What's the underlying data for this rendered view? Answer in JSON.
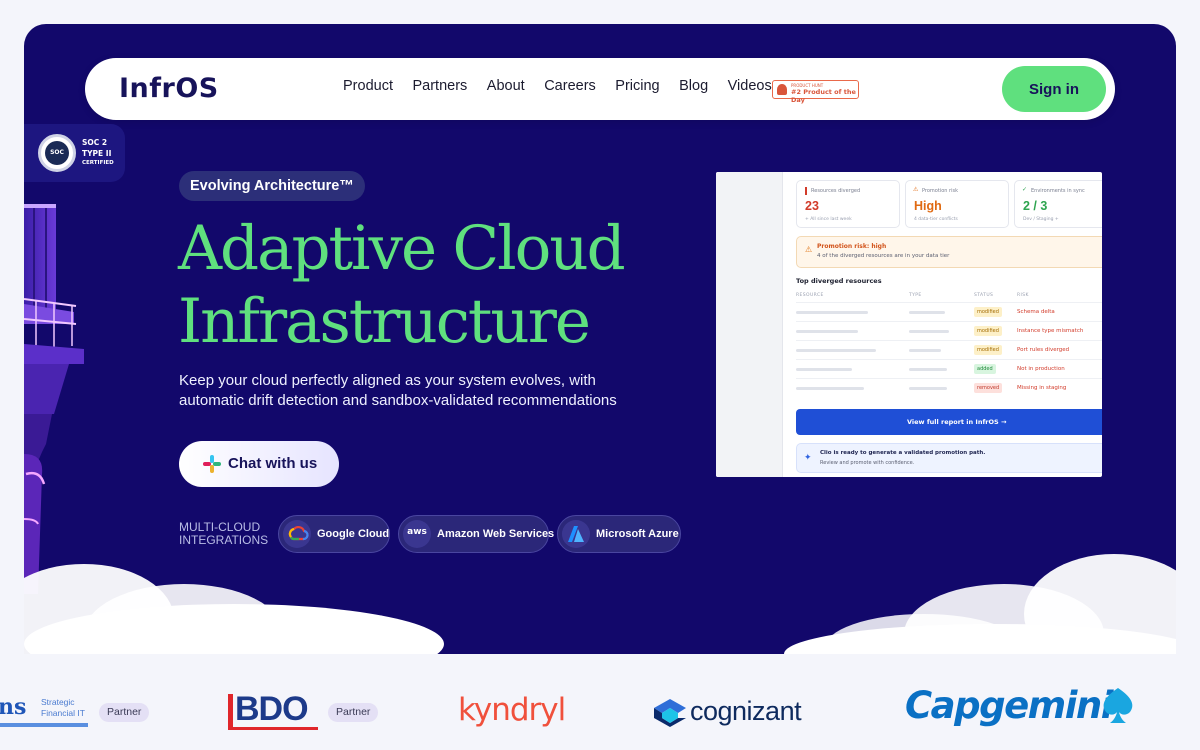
{
  "nav": {
    "logo": "InfrOS",
    "links": [
      "Product",
      "Partners",
      "About",
      "Careers",
      "Pricing",
      "Blog",
      "Videos"
    ],
    "product_hunt": {
      "small": "PRODUCT HUNT",
      "big": "#2 Product of the Day"
    },
    "signin": "Sign in"
  },
  "soc": {
    "line1": "SOC 2",
    "line2": "TYPE II",
    "line3": "CERTIFIED",
    "seal": "SOC"
  },
  "hero": {
    "pill": "Evolving Architecture™",
    "headline_line1": "Adaptive Cloud",
    "headline_line2": "Infrastructure",
    "subtext_line1": "Keep your cloud perfectly aligned as your system evolves, with",
    "subtext_line2": "automatic drift detection and sandbox-validated recommendations",
    "chat_button": "Chat with us",
    "integrations_label_line1": "MULTI-CLOUD",
    "integrations_label_line2": "INTEGRATIONS",
    "integrations": [
      {
        "name": "Google Cloud",
        "icon": "google-cloud-icon"
      },
      {
        "name": "Amazon Web Services",
        "icon": "aws-icon",
        "glyph": "aws"
      },
      {
        "name": "Microsoft Azure",
        "icon": "azure-icon"
      }
    ]
  },
  "dashboard": {
    "stats": [
      {
        "label": "Resources diverged",
        "value": "23",
        "sub": "+ All since last week",
        "color": "#d23b2a"
      },
      {
        "label": "Promotion risk",
        "value": "High",
        "sub": "4 data-tier conflicts",
        "color": "#e06a12"
      },
      {
        "label": "Environments in sync",
        "value": "2 / 3",
        "sub": "Dev / Staging +",
        "color": "#2ea44f"
      }
    ],
    "risk_title": "Promotion risk: high",
    "risk_sub": "4 of the diverged resources are in your data tier",
    "table_title": "Top diverged resources",
    "headers": [
      "RESOURCE",
      "TYPE",
      "STATUS",
      "RISK"
    ],
    "rows": [
      {
        "status": "modified",
        "risk": "Schema delta"
      },
      {
        "status": "modified",
        "risk": "Instance type mismatch"
      },
      {
        "status": "modified",
        "risk": "Port rules diverged"
      },
      {
        "status": "added",
        "risk": "Not in production"
      },
      {
        "status": "removed",
        "risk": "Missing in staging"
      }
    ],
    "view_button": "View full report in InfrOS →",
    "clio_title": "Clio is ready to generate a validated promotion path.",
    "clio_sub": "Review and promote with confidence."
  },
  "partners": [
    {
      "name": "ns",
      "sub1": "Strategic",
      "sub2": "Financial IT",
      "tag": "Partner"
    },
    {
      "name": "BDO",
      "tag": "Partner"
    },
    {
      "name": "kyndryl"
    },
    {
      "name": "cognizant"
    },
    {
      "name": "Capgemini"
    }
  ],
  "colors": {
    "hero_bg": "#12086b",
    "accent_green": "#5fe07e",
    "navy": "#17135a"
  }
}
